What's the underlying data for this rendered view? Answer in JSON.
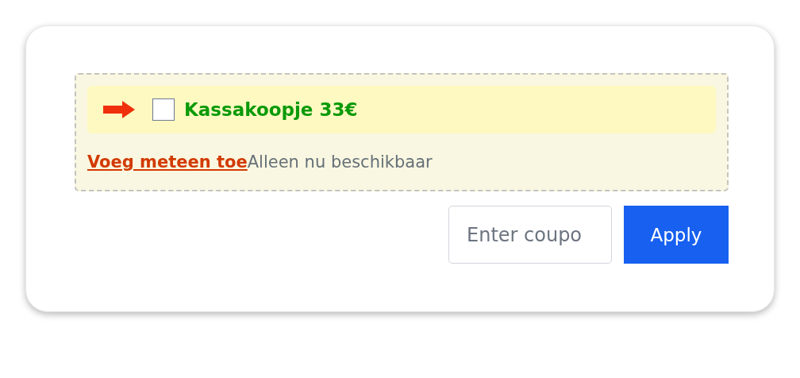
{
  "offer": {
    "title": "Kassakoopje 33€",
    "checked": false,
    "link": "Voeg meteen toe",
    "note": "Alleen nu beschikbaar"
  },
  "coupon": {
    "placeholder": "Enter coupo",
    "button": "Apply"
  }
}
